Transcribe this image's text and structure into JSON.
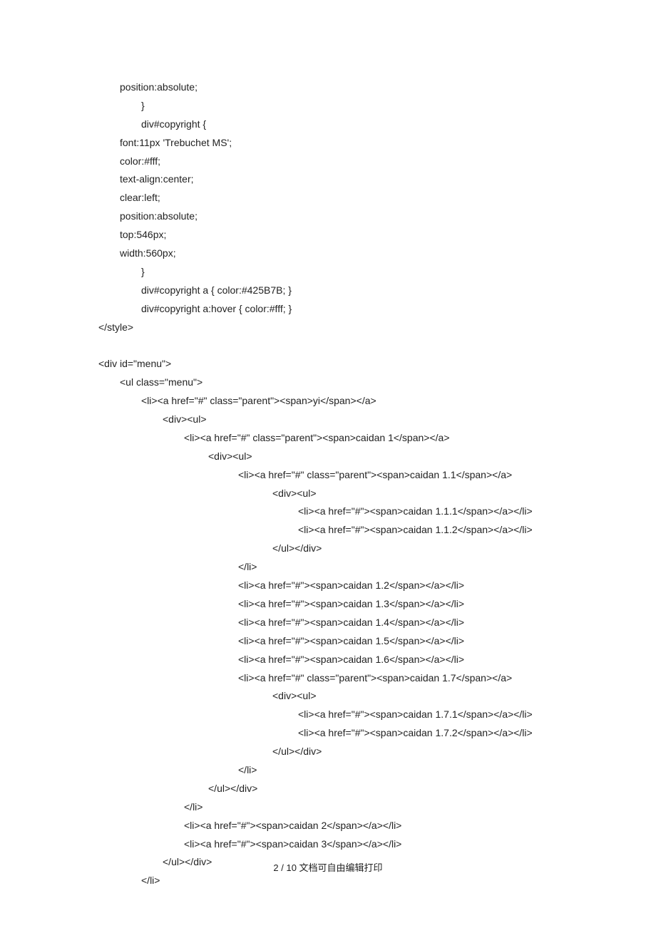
{
  "lines": [
    {
      "indent": 1,
      "text": "position:absolute;"
    },
    {
      "indent": 2,
      "text": "}"
    },
    {
      "indent": 2,
      "text": "div#copyright {"
    },
    {
      "indent": 1,
      "text": "font:11px 'Trebuchet MS';"
    },
    {
      "indent": 1,
      "text": "color:#fff;"
    },
    {
      "indent": 1,
      "text": "text-align:center;"
    },
    {
      "indent": 1,
      "text": "clear:left;"
    },
    {
      "indent": 1,
      "text": "position:absolute;"
    },
    {
      "indent": 1,
      "text": "top:546px;"
    },
    {
      "indent": 1,
      "text": "width:560px;"
    },
    {
      "indent": 2,
      "text": "}"
    },
    {
      "indent": 2,
      "text": "div#copyright a { color:#425B7B; }"
    },
    {
      "indent": 2,
      "text": "div#copyright a:hover { color:#fff; }"
    },
    {
      "indent": 0,
      "text": "</style>"
    },
    {
      "indent": 0,
      "text": ""
    },
    {
      "indent": 0,
      "text": "<div id=\"menu\">"
    },
    {
      "indent": 1,
      "text": "<ul class=\"menu\">"
    },
    {
      "indent": 2,
      "text": "<li><a href=\"#\" class=\"parent\"><span>yi</span></a>"
    },
    {
      "indent": 3,
      "text": "<div><ul>"
    },
    {
      "indent": 4,
      "text": "<li><a href=\"#\" class=\"parent\"><span>caidan 1</span></a>"
    },
    {
      "indent": 5,
      "text": "<div><ul>"
    },
    {
      "indent": 6,
      "text": "<li><a href=\"#\" class=\"parent\"><span>caidan 1.1</span></a>"
    },
    {
      "indent": 7,
      "text": "<div><ul>"
    },
    {
      "indent": 8,
      "text": "<li><a href=\"#\"><span>caidan 1.1.1</span></a></li>"
    },
    {
      "indent": 8,
      "text": "<li><a href=\"#\"><span>caidan 1.1.2</span></a></li>"
    },
    {
      "indent": 7,
      "text": "</ul></div>"
    },
    {
      "indent": 6,
      "text": "</li>"
    },
    {
      "indent": 6,
      "text": "<li><a href=\"#\"><span>caidan 1.2</span></a></li>"
    },
    {
      "indent": 6,
      "text": "<li><a href=\"#\"><span>caidan 1.3</span></a></li>"
    },
    {
      "indent": 6,
      "text": "<li><a href=\"#\"><span>caidan 1.4</span></a></li>"
    },
    {
      "indent": 6,
      "text": "<li><a href=\"#\"><span>caidan 1.5</span></a></li>"
    },
    {
      "indent": 6,
      "text": "<li><a href=\"#\"><span>caidan 1.6</span></a></li>"
    },
    {
      "indent": 6,
      "text": "<li><a href=\"#\" class=\"parent\"><span>caidan 1.7</span></a>"
    },
    {
      "indent": 7,
      "text": "<div><ul>"
    },
    {
      "indent": 8,
      "text": "<li><a href=\"#\"><span>caidan 1.7.1</span></a></li>"
    },
    {
      "indent": 8,
      "text": "<li><a href=\"#\"><span>caidan 1.7.2</span></a></li>"
    },
    {
      "indent": 7,
      "text": "</ul></div>"
    },
    {
      "indent": 6,
      "text": "</li>"
    },
    {
      "indent": 5,
      "text": "</ul></div>"
    },
    {
      "indent": 4,
      "text": "</li>"
    },
    {
      "indent": 4,
      "text": "<li><a href=\"#\"><span>caidan 2</span></a></li>"
    },
    {
      "indent": 4,
      "text": "<li><a href=\"#\"><span>caidan 3</span></a></li>"
    },
    {
      "indent": 3,
      "text": "</ul></div>"
    },
    {
      "indent": 2,
      "text": "</li>"
    }
  ],
  "footer": "2 / 10 文档可自由编辑打印"
}
